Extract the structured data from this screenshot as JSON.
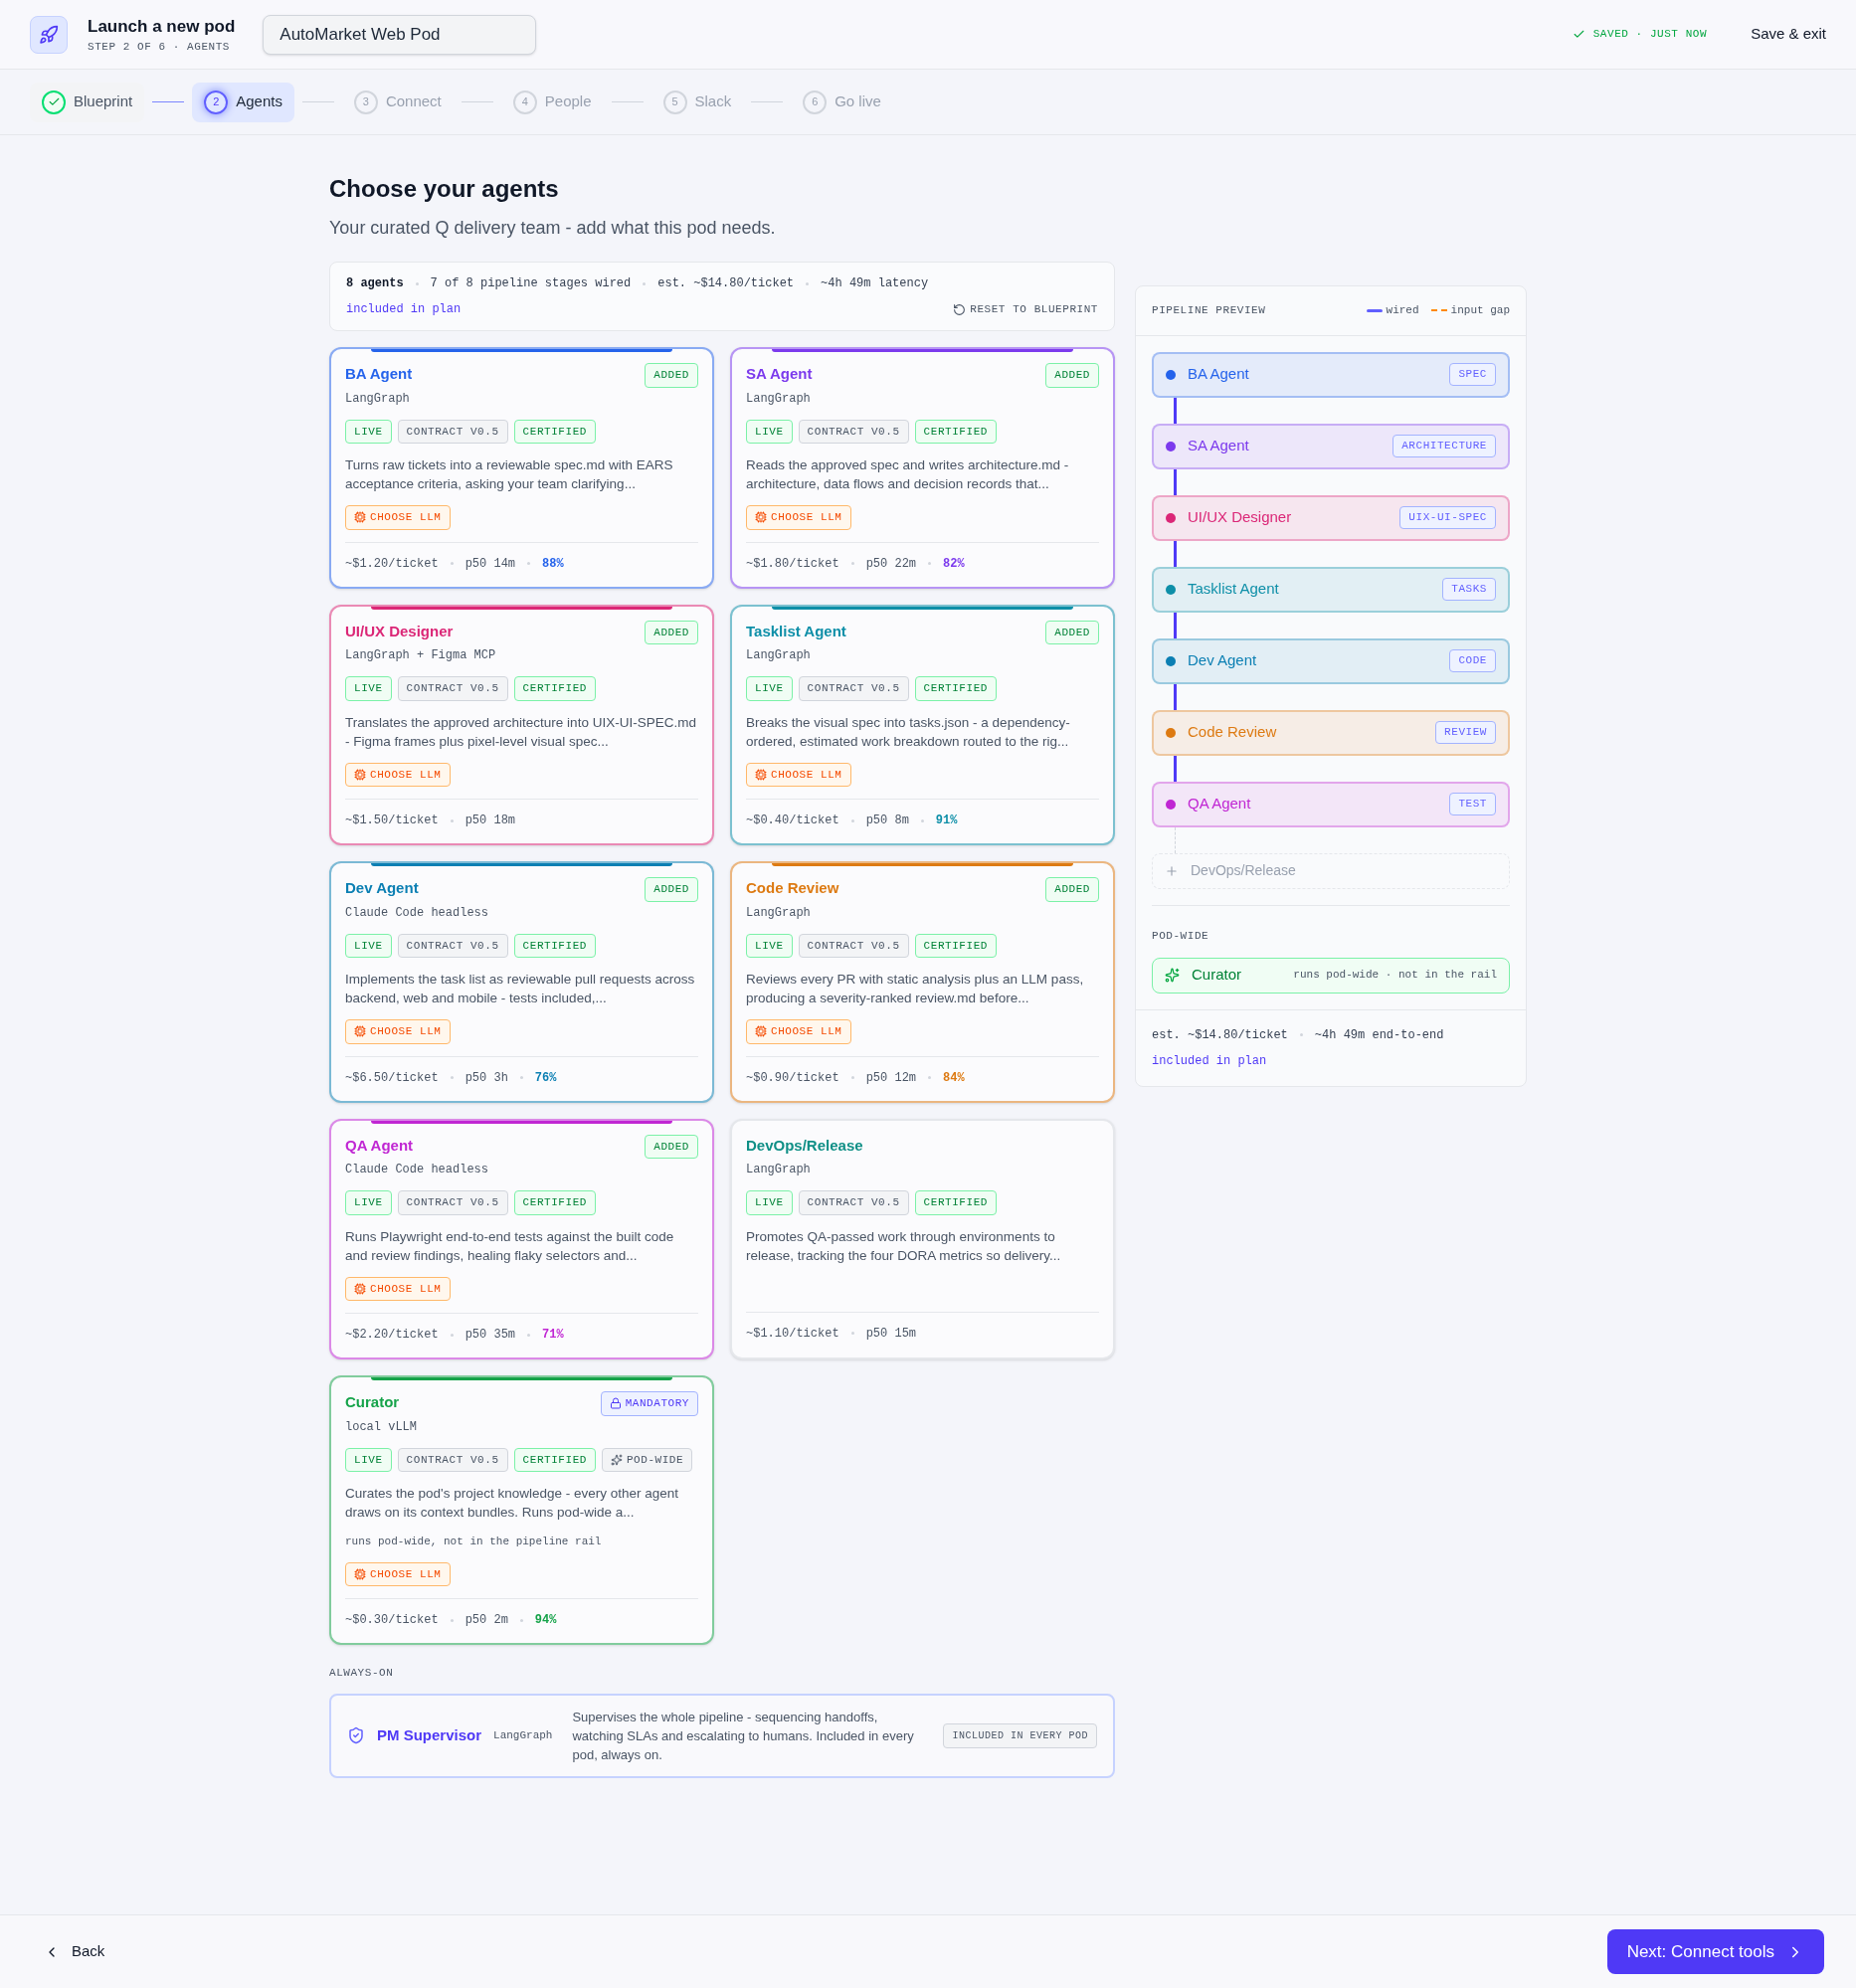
{
  "header": {
    "title": "Launch a new pod",
    "subtitle": "STEP 2 OF 6 · AGENTS",
    "pod_name": "AutoMarket Web Pod",
    "save_status": "SAVED · JUST NOW",
    "save_exit": "Save & exit"
  },
  "steps": [
    {
      "label": "Blueprint",
      "done": true,
      "selected": false
    },
    {
      "number": "2",
      "label": "Agents",
      "done": false,
      "selected": true
    },
    {
      "number": "3",
      "label": "Connect",
      "done": false,
      "selected": false
    },
    {
      "number": "4",
      "label": "People",
      "done": false,
      "selected": false
    },
    {
      "number": "5",
      "label": "Slack",
      "done": false,
      "selected": false
    },
    {
      "number": "6",
      "label": "Go live",
      "done": false,
      "selected": false
    }
  ],
  "page": {
    "title": "Choose your agents",
    "subtitle": "Your curated Q delivery team - add what this pod needs."
  },
  "summary": {
    "agents": "8 agents",
    "stats": [
      "7 of 8 pipeline stages wired",
      "est. ~$14.80/ticket",
      "~4h 49m latency"
    ],
    "plan": "included in plan",
    "reset": "RESET TO BLUEPRINT"
  },
  "agents": [
    {
      "name": "BA Agent",
      "runtime": "LangGraph",
      "color": "#2563eb",
      "added": true,
      "badge": {
        "kind": "added",
        "label": "ADDED"
      },
      "tags": [
        {
          "kind": "live",
          "label": "LIVE"
        },
        {
          "kind": "plain",
          "label": "CONTRACT V0.5"
        },
        {
          "kind": "live",
          "label": "CERTIFIED"
        }
      ],
      "description": "Turns raw tickets into a reviewable spec.md with EARS acceptance criteria, asking your team clarifying...",
      "llm": "CHOOSE LLM",
      "cost": "~$1.20/ticket",
      "p50": "p50 14m",
      "score": "88%"
    },
    {
      "name": "SA Agent",
      "runtime": "LangGraph",
      "color": "#7c3aed",
      "added": true,
      "badge": {
        "kind": "added",
        "label": "ADDED"
      },
      "tags": [
        {
          "kind": "live",
          "label": "LIVE"
        },
        {
          "kind": "plain",
          "label": "CONTRACT V0.5"
        },
        {
          "kind": "live",
          "label": "CERTIFIED"
        }
      ],
      "description": "Reads the approved spec and writes architecture.md - architecture, data flows and decision records that...",
      "llm": "CHOOSE LLM",
      "cost": "~$1.80/ticket",
      "p50": "p50 22m",
      "score": "82%"
    },
    {
      "name": "UI/UX Designer",
      "runtime": "LangGraph + Figma MCP",
      "color": "#db2777",
      "added": true,
      "badge": {
        "kind": "added",
        "label": "ADDED"
      },
      "tags": [
        {
          "kind": "live",
          "label": "LIVE"
        },
        {
          "kind": "plain",
          "label": "CONTRACT V0.5"
        },
        {
          "kind": "live",
          "label": "CERTIFIED"
        }
      ],
      "description": "Translates the approved architecture into UIX-UI-SPEC.md - Figma frames plus pixel-level visual spec...",
      "llm": "CHOOSE LLM",
      "cost": "~$1.50/ticket",
      "p50": "p50 18m"
    },
    {
      "name": "Tasklist Agent",
      "runtime": "LangGraph",
      "color": "#0e8fa8",
      "added": true,
      "badge": {
        "kind": "added",
        "label": "ADDED"
      },
      "tags": [
        {
          "kind": "live",
          "label": "LIVE"
        },
        {
          "kind": "plain",
          "label": "CONTRACT V0.5"
        },
        {
          "kind": "live",
          "label": "CERTIFIED"
        }
      ],
      "description": "Breaks the visual spec into tasks.json - a dependency-ordered, estimated work breakdown routed to the rig...",
      "llm": "CHOOSE LLM",
      "cost": "~$0.40/ticket",
      "p50": "p50 8m",
      "score": "91%"
    },
    {
      "name": "Dev Agent",
      "runtime": "Claude Code headless",
      "color": "#0b7fb3",
      "added": true,
      "badge": {
        "kind": "added",
        "label": "ADDED"
      },
      "tags": [
        {
          "kind": "live",
          "label": "LIVE"
        },
        {
          "kind": "plain",
          "label": "CONTRACT V0.5"
        },
        {
          "kind": "live",
          "label": "CERTIFIED"
        }
      ],
      "description": "Implements the task list as reviewable pull requests across backend, web and mobile - tests included,...",
      "llm": "CHOOSE LLM",
      "cost": "~$6.50/ticket",
      "p50": "p50 3h",
      "score": "76%"
    },
    {
      "name": "Code Review",
      "runtime": "LangGraph",
      "color": "#dd7a12",
      "added": true,
      "badge": {
        "kind": "added",
        "label": "ADDED"
      },
      "tags": [
        {
          "kind": "live",
          "label": "LIVE"
        },
        {
          "kind": "plain",
          "label": "CONTRACT V0.5"
        },
        {
          "kind": "live",
          "label": "CERTIFIED"
        }
      ],
      "description": "Reviews every PR with static analysis plus an LLM pass, producing a severity-ranked review.md before...",
      "llm": "CHOOSE LLM",
      "cost": "~$0.90/ticket",
      "p50": "p50 12m",
      "score": "84%"
    },
    {
      "name": "QA Agent",
      "runtime": "Claude Code headless",
      "color": "#c026d3",
      "added": true,
      "badge": {
        "kind": "added",
        "label": "ADDED"
      },
      "tags": [
        {
          "kind": "live",
          "label": "LIVE"
        },
        {
          "kind": "plain",
          "label": "CONTRACT V0.5"
        },
        {
          "kind": "live",
          "label": "CERTIFIED"
        }
      ],
      "description": "Runs Playwright end-to-end tests against the built code and review findings, healing flaky selectors and...",
      "llm": "CHOOSE LLM",
      "cost": "~$2.20/ticket",
      "p50": "p50 35m",
      "score": "71%"
    },
    {
      "name": "DevOps/Release",
      "runtime": "LangGraph",
      "color": "#0f8f86",
      "added": false,
      "tags": [
        {
          "kind": "live",
          "label": "LIVE"
        },
        {
          "kind": "plain",
          "label": "CONTRACT V0.5"
        },
        {
          "kind": "live",
          "label": "CERTIFIED"
        }
      ],
      "description": "Promotes QA-passed work through environments to release, tracking the four DORA metrics so delivery...",
      "cost": "~$1.10/ticket",
      "p50": "p50 15m"
    },
    {
      "name": "Curator",
      "runtime": "local vLLM",
      "color": "#16a34a",
      "added": true,
      "badge": {
        "kind": "mandatory",
        "label": "MANDATORY"
      },
      "tags": [
        {
          "kind": "live",
          "label": "LIVE"
        },
        {
          "kind": "plain",
          "label": "CONTRACT V0.5"
        },
        {
          "kind": "live",
          "label": "CERTIFIED"
        },
        {
          "kind": "podwide",
          "label": "POD-WIDE"
        }
      ],
      "description": "Curates the pod's project knowledge - every other agent draws on its context bundles. Runs pod-wide a...",
      "note": "runs pod-wide, not in the pipeline rail",
      "llm": "CHOOSE LLM",
      "cost": "~$0.30/ticket",
      "p50": "p50 2m",
      "score": "94%"
    }
  ],
  "always_on": {
    "heading": "ALWAYS-ON",
    "name": "PM Supervisor",
    "runtime": "LangGraph",
    "description": "Supervises the whole pipeline - sequencing handoffs, watching SLAs and escalating to humans. Included in every pod, always on.",
    "badge": "INCLUDED IN EVERY POD"
  },
  "pipeline": {
    "title": "PIPELINE PREVIEW",
    "legend": [
      {
        "kind": "wired",
        "label": "wired"
      },
      {
        "kind": "gap",
        "label": "input gap"
      }
    ],
    "stages": [
      {
        "kind": "stage",
        "name": "BA Agent",
        "artifact": "SPEC",
        "color": "#2563eb"
      },
      {
        "kind": "stage",
        "name": "SA Agent",
        "artifact": "ARCHITECTURE",
        "color": "#7c3aed"
      },
      {
        "kind": "stage",
        "name": "UI/UX Designer",
        "artifact": "UIX-UI-SPEC",
        "color": "#db2777"
      },
      {
        "kind": "stage",
        "name": "Tasklist Agent",
        "artifact": "TASKS",
        "color": "#0e8fa8"
      },
      {
        "kind": "stage",
        "name": "Dev Agent",
        "artifact": "CODE",
        "color": "#0b7fb3"
      },
      {
        "kind": "stage",
        "name": "Code Review",
        "artifact": "REVIEW",
        "color": "#dd7a12"
      },
      {
        "kind": "stage",
        "name": "QA Agent",
        "artifact": "TEST",
        "color": "#c026d3"
      },
      {
        "kind": "add",
        "name": "DevOps/Release"
      }
    ],
    "pod_wide_heading": "POD-WIDE",
    "pod_wide": {
      "name": "Curator",
      "note": "runs pod-wide · not in the rail"
    },
    "totals": [
      "est. ~$14.80/ticket",
      "~4h 49m end-to-end"
    ],
    "plan": "included in plan"
  },
  "footer": {
    "back": "Back",
    "next": "Next: Connect tools"
  }
}
